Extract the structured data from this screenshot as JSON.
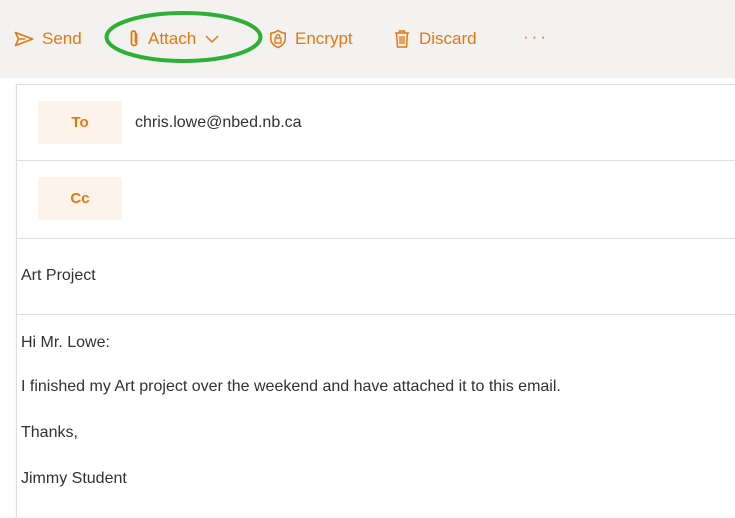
{
  "toolbar": {
    "send_label": "Send",
    "attach_label": "Attach",
    "encrypt_label": "Encrypt",
    "discard_label": "Discard",
    "more_label": "···",
    "icons": {
      "send": "send-arrow-icon",
      "attach": "paperclip-icon",
      "attach_dropdown": "chevron-down-icon",
      "encrypt": "shield-lock-icon",
      "discard": "trash-icon"
    }
  },
  "compose": {
    "to_label": "To",
    "to_value": "chris.lowe@nbed.nb.ca",
    "cc_label": "Cc",
    "cc_value": "",
    "subject": "Art Project",
    "body_lines": [
      "Hi Mr. Lowe:",
      "I finished my Art project over the weekend and have attached it to this email.",
      "Thanks,",
      "Jimmy Student"
    ]
  },
  "colors": {
    "accent": "#e4780f",
    "highlight_ring": "#2db035",
    "toolbar_bg": "#f3f2f1",
    "recipient_button_bg": "#fdf3ea"
  }
}
